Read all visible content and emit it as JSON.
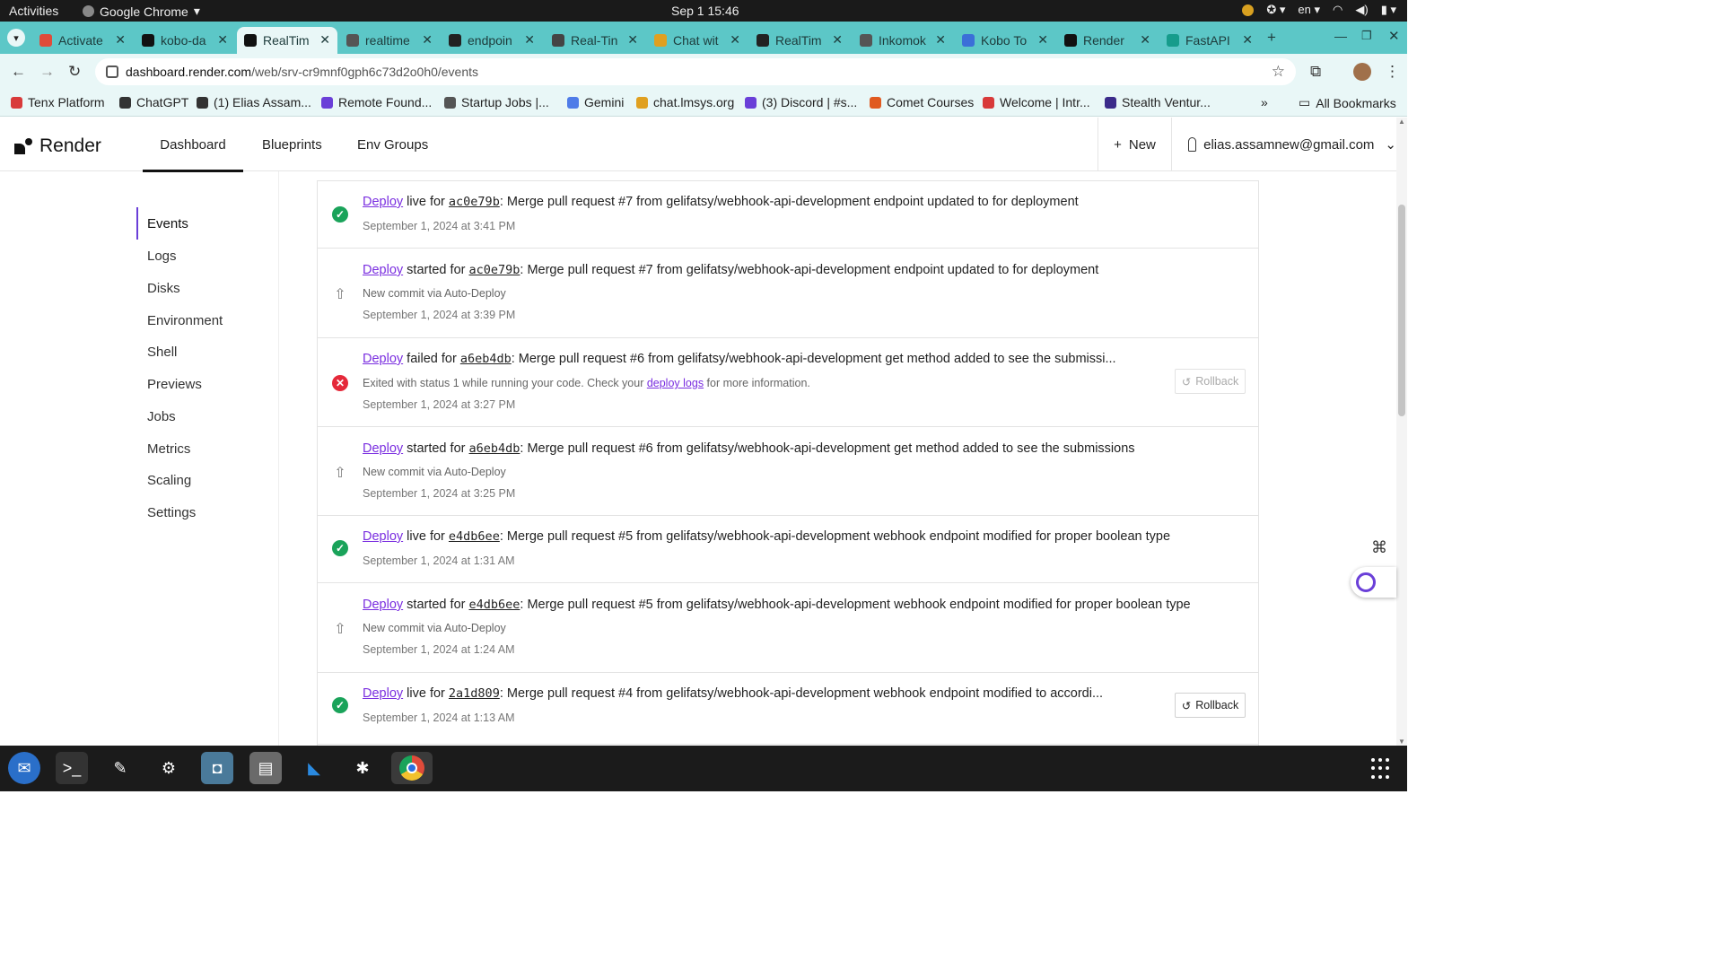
{
  "system": {
    "activities": "Activities",
    "app_name": "Google Chrome",
    "clock": "Sep 1  15:46",
    "lang": "en"
  },
  "tabs": [
    {
      "title": "Activate",
      "color": "#e04b3a"
    },
    {
      "title": "kobo-da",
      "color": "#111111"
    },
    {
      "title": "RealTim",
      "color": "#111111",
      "active": true
    },
    {
      "title": "realtime",
      "color": "#555555"
    },
    {
      "title": "endpoin",
      "color": "#222222"
    },
    {
      "title": "Real-Tin",
      "color": "#444444"
    },
    {
      "title": "Chat wit",
      "color": "#e0a020"
    },
    {
      "title": "RealTim",
      "color": "#222222"
    },
    {
      "title": "Inkomok",
      "color": "#555555"
    },
    {
      "title": "Kobo To",
      "color": "#3b6fd8"
    },
    {
      "title": "Render",
      "color": "#111111"
    },
    {
      "title": "FastAPI",
      "color": "#169c8c"
    }
  ],
  "address_bar": {
    "host": "dashboard.render.com",
    "path": "/web/srv-cr9mnf0gph6c73d2o0h0/events"
  },
  "bookmarks": [
    {
      "label": "Tenx Platform",
      "color": "#d83a3a"
    },
    {
      "label": "ChatGPT",
      "color": "#333333"
    },
    {
      "label": "(1) Elias Assam...",
      "color": "#333333"
    },
    {
      "label": "Remote Found...",
      "color": "#6a3fd8"
    },
    {
      "label": "Startup Jobs |...",
      "color": "#555555"
    },
    {
      "label": "Gemini",
      "color": "#4f7ce8"
    },
    {
      "label": "chat.lmsys.org",
      "color": "#e0a020"
    },
    {
      "label": "(3) Discord | #s...",
      "color": "#6a3fd8"
    },
    {
      "label": "Comet Courses",
      "color": "#e05a20"
    },
    {
      "label": "Welcome | Intr...",
      "color": "#d83a3a"
    },
    {
      "label": "Stealth Ventur...",
      "color": "#3b2b8a"
    }
  ],
  "bookmarks_overflow": "»",
  "all_bookmarks": "All Bookmarks",
  "header": {
    "brand": "Render",
    "nav": [
      "Dashboard",
      "Blueprints",
      "Env Groups"
    ],
    "new_label": "New",
    "user_email": "elias.assamnew@gmail.com"
  },
  "sidebar": [
    "Events",
    "Logs",
    "Disks",
    "Environment",
    "Shell",
    "Previews",
    "Jobs",
    "Metrics",
    "Scaling",
    "Settings"
  ],
  "events": [
    {
      "status": "ok",
      "link": "Deploy",
      "verb": "live",
      "commit": "ac0e79b",
      "message": ": Merge pull request #7 from gelifatsy/webhook-api-development endpoint updated to for deployment",
      "sub": "",
      "date": "September 1, 2024 at 3:41 PM"
    },
    {
      "status": "start",
      "link": "Deploy",
      "verb": "started",
      "commit": "ac0e79b",
      "message": ": Merge pull request #7 from gelifatsy/webhook-api-development endpoint updated to for deployment",
      "sub": "New commit via Auto-Deploy",
      "date": "September 1, 2024 at 3:39 PM"
    },
    {
      "status": "fail",
      "link": "Deploy",
      "verb": "failed",
      "commit": "a6eb4db",
      "message": ": Merge pull request #6 from gelifatsy/webhook-api-development get method added to see the submissi...",
      "sub_prefix": "Exited with status 1 while running your code. Check your ",
      "sub_link": "deploy logs",
      "sub_suffix": " for more information.",
      "date": "September 1, 2024 at 3:27 PM",
      "rollback": "Rollback"
    },
    {
      "status": "start",
      "link": "Deploy",
      "verb": "started",
      "commit": "a6eb4db",
      "message": ": Merge pull request #6 from gelifatsy/webhook-api-development get method added to see the submissions",
      "sub": "New commit via Auto-Deploy",
      "date": "September 1, 2024 at 3:25 PM"
    },
    {
      "status": "ok",
      "link": "Deploy",
      "verb": "live",
      "commit": "e4db6ee",
      "message": ": Merge pull request #5 from gelifatsy/webhook-api-development webhook endpoint modified for proper boolean type",
      "sub": "",
      "date": "September 1, 2024 at 1:31 AM"
    },
    {
      "status": "start",
      "link": "Deploy",
      "verb": "started",
      "commit": "e4db6ee",
      "message": ": Merge pull request #5 from gelifatsy/webhook-api-development webhook endpoint modified for proper boolean type",
      "sub": "New commit via Auto-Deploy",
      "date": "September 1, 2024 at 1:24 AM"
    },
    {
      "status": "ok",
      "link": "Deploy",
      "verb": "live",
      "commit": "2a1d809",
      "message": ": Merge pull request #4 from gelifatsy/webhook-api-development webhook endpoint modified to accordi...",
      "sub": "",
      "date": "September 1, 2024 at 1:13 AM",
      "rollback": "Rollback"
    }
  ],
  "colors": {
    "accent_purple": "#7a2ee0",
    "success_green": "#1aa35a",
    "fail_red": "#e5293a",
    "tabstrip": "#5cc7c7"
  }
}
